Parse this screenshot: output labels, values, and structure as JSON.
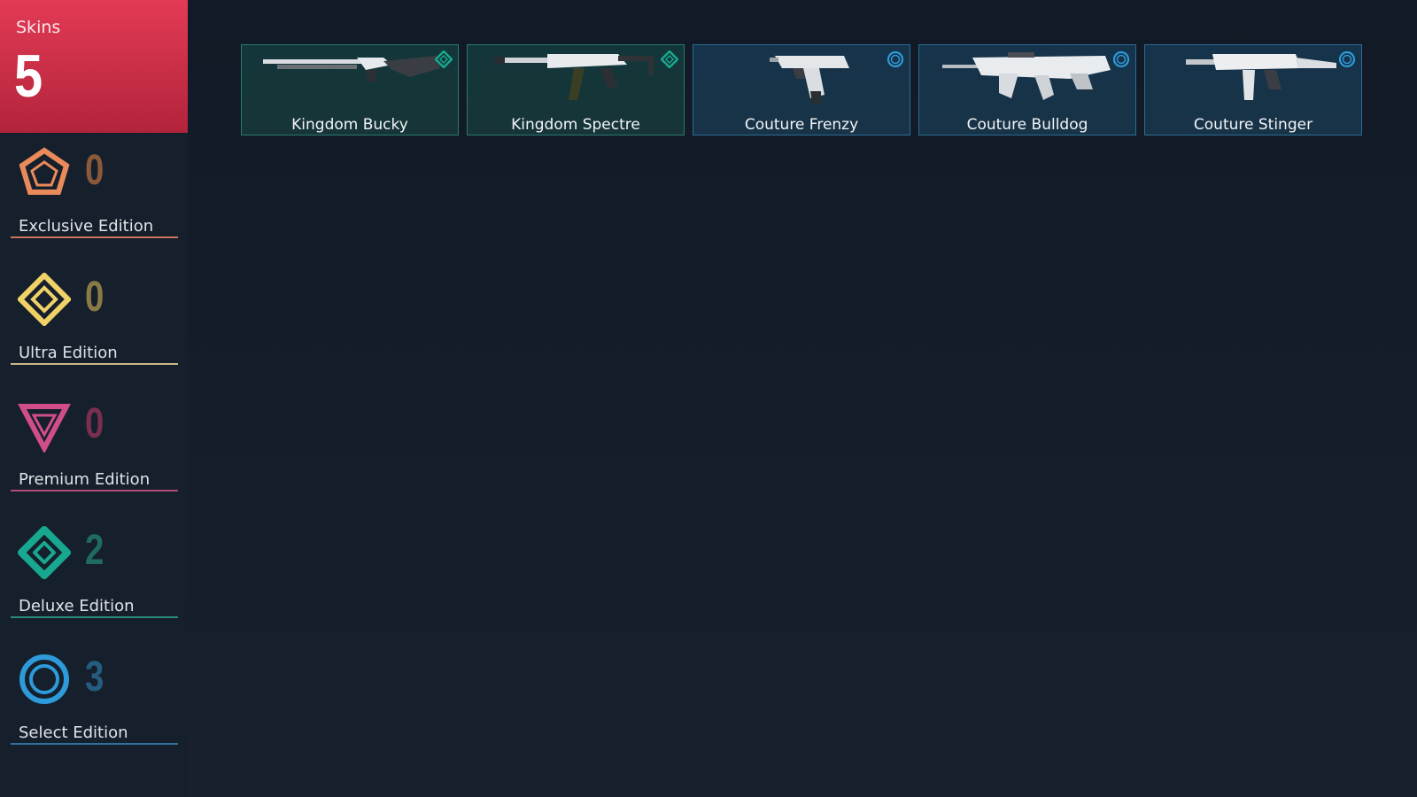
{
  "summary": {
    "title": "Skins",
    "count": "5"
  },
  "editions": [
    {
      "label": "Exclusive Edition",
      "count": "0",
      "icon": "exclusive-edition-icon",
      "color": "#e98a5a",
      "count_color": "#8a5a3a",
      "line_color": "#c8745a"
    },
    {
      "label": "Ultra Edition",
      "count": "0",
      "icon": "ultra-edition-icon",
      "color": "#f1d267",
      "count_color": "#8a7a46",
      "line_color": "#c9b98a"
    },
    {
      "label": "Premium Edition",
      "count": "0",
      "icon": "premium-edition-icon",
      "color": "#d04d8c",
      "count_color": "#7a2f4e",
      "line_color": "#b24c74"
    },
    {
      "label": "Deluxe Edition",
      "count": "2",
      "icon": "deluxe-edition-icon",
      "color": "#17a88f",
      "count_color": "#1f6b60",
      "line_color": "#2a8c7c"
    },
    {
      "label": "Select Edition",
      "count": "3",
      "icon": "select-edition-icon",
      "color": "#2d9ad9",
      "count_color": "#245d80",
      "line_color": "#2f6f9c"
    }
  ],
  "skins": [
    {
      "name": "Kingdom Bucky",
      "edition": "deluxe",
      "gun": "shotgun-icon"
    },
    {
      "name": "Kingdom Spectre",
      "edition": "deluxe",
      "gun": "smg-icon"
    },
    {
      "name": "Couture Frenzy",
      "edition": "select",
      "gun": "pistol-icon"
    },
    {
      "name": "Couture Bulldog",
      "edition": "select",
      "gun": "rifle-icon"
    },
    {
      "name": "Couture Stinger",
      "edition": "select",
      "gun": "smg-icon"
    }
  ]
}
